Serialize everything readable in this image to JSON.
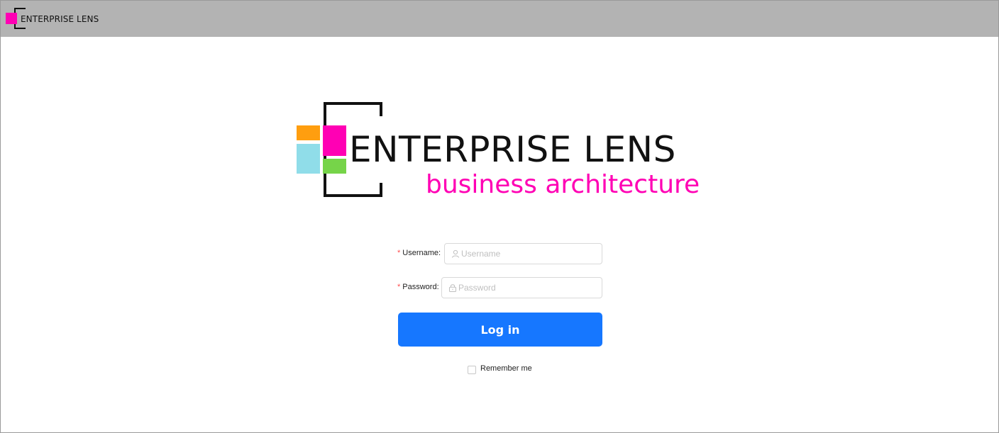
{
  "header": {
    "brand_text": "ENTERPRISE LENS"
  },
  "logo": {
    "title": "ENTERPRISE LENS",
    "subtitle": "business architecture",
    "colors": {
      "pink": "#ff00b4",
      "orange": "#ff9e0f",
      "blue": "#90dde9",
      "green": "#76d449",
      "bracket": "#111111"
    }
  },
  "form": {
    "username": {
      "label": "Username",
      "required_mark": "*",
      "placeholder": "Username",
      "value": "",
      "icon": "user-icon"
    },
    "password": {
      "label": "Password",
      "required_mark": "*",
      "placeholder": "Password",
      "value": "",
      "icon": "lock-icon"
    },
    "login_label": "Log in",
    "remember_label": "Remember me",
    "remember_checked": false,
    "accent_color": "#1677ff"
  }
}
